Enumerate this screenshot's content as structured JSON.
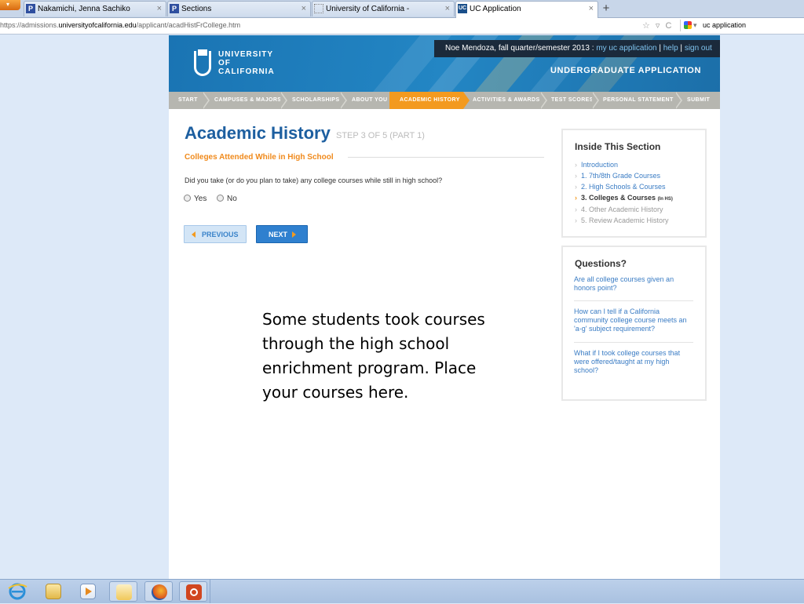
{
  "browser": {
    "tabs": [
      {
        "title": "Nakamichi, Jenna Sachiko",
        "icon": "p-icon",
        "active": false
      },
      {
        "title": "Sections",
        "icon": "p-icon",
        "active": false
      },
      {
        "title": "University of California -",
        "icon": "blank-page-icon",
        "active": false
      },
      {
        "title": "UC Application",
        "icon": "uc-icon",
        "active": true
      }
    ],
    "new_tab": "+",
    "url_prefix": "https://admissions.",
    "url_domain": "universityofcalifornia.edu",
    "url_path": "/applicant/acadHistFrCollege.htm",
    "search_text": "uc application"
  },
  "header": {
    "logo": [
      "UNIVERSITY",
      "OF",
      "CALIFORNIA"
    ],
    "user_text": "Noe Mendoza, fall quarter/semester 2013 :",
    "links": [
      "my uc application",
      "help",
      "sign out"
    ],
    "app_title": "UNDERGRADUATE APPLICATION"
  },
  "steps": [
    {
      "label": "START"
    },
    {
      "label": "CAMPUSES & MAJORS"
    },
    {
      "label": "SCHOLARSHIPS"
    },
    {
      "label": "ABOUT YOU"
    },
    {
      "label": "ACADEMIC HISTORY",
      "active": true
    },
    {
      "label": "ACTIVITIES & AWARDS"
    },
    {
      "label": "TEST SCORES"
    },
    {
      "label": "PERSONAL STATEMENT"
    },
    {
      "label": "SUBMIT"
    }
  ],
  "main": {
    "title": "Academic History",
    "step": "STEP 3 OF 5 (PART 1)",
    "subheading": "Colleges Attended While in High School",
    "question": "Did you take (or do you plan to take) any college courses while still in high school?",
    "options": [
      "Yes",
      "No"
    ],
    "prev_label": "PREVIOUS",
    "next_label": "NEXT"
  },
  "inside": {
    "title": "Inside This Section",
    "items": [
      {
        "label": "Introduction"
      },
      {
        "label": "1. 7th/8th Grade Courses"
      },
      {
        "label": "2. High Schools & Courses"
      },
      {
        "label": "3. Colleges & Courses",
        "suffix": "(In HS)",
        "current": true
      },
      {
        "label": "4. Other Academic History",
        "muted": true
      },
      {
        "label": "5. Review Academic History",
        "muted": true
      }
    ]
  },
  "questions": {
    "title": "Questions?",
    "items": [
      "Are all college courses given an honors point?",
      "How can I tell if a California community college course meets an 'a-g' subject requirement?",
      "What if I took college courses that were offered/taught at my high school?"
    ]
  },
  "overlay_text": "Some students took courses through the high school enrichment program. Place your courses here.",
  "colors": {
    "brand_blue": "#1a74b3",
    "accent_orange": "#f39a1f",
    "link_blue": "#3a7cc4"
  }
}
